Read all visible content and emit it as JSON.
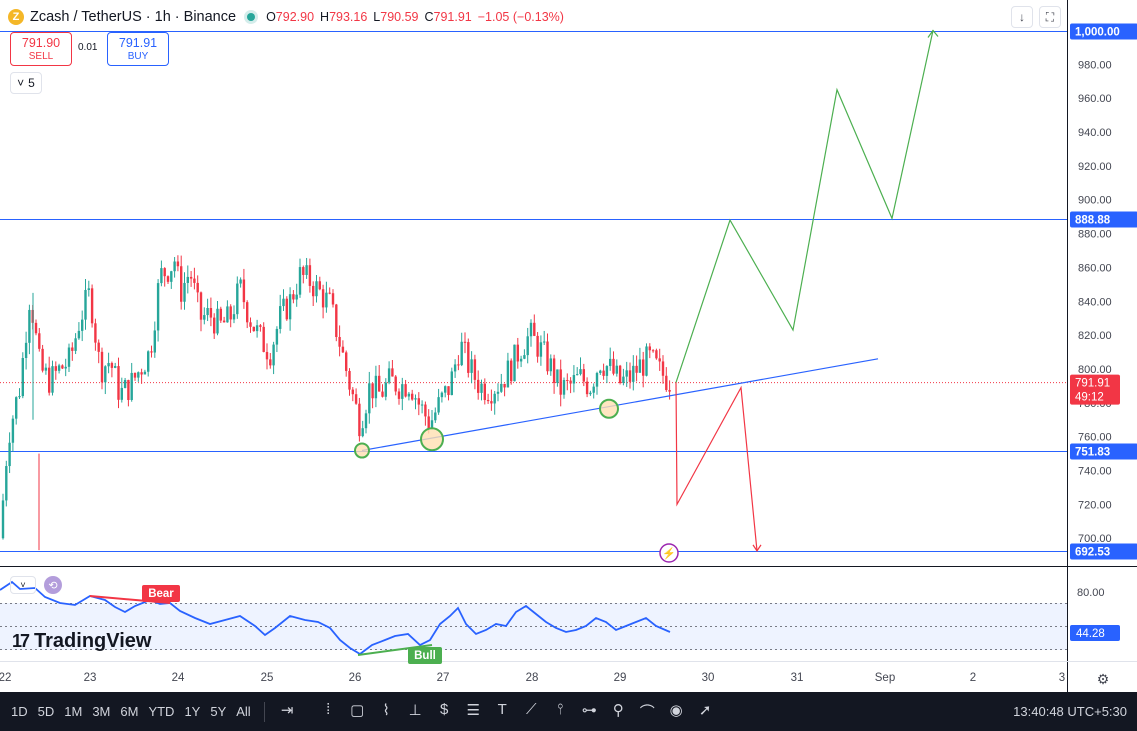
{
  "header": {
    "symbol": "Zcash / TetherUS · 1h · Binance",
    "coin_glyph": "Z",
    "open_label": "O",
    "open": "792.90",
    "high_label": "H",
    "high": "793.16",
    "low_label": "L",
    "low": "790.59",
    "close_label": "C",
    "close": "791.91",
    "change": "−1.05 (−0.13%)",
    "indicator_count": "5",
    "chevron": "˅"
  },
  "trade": {
    "sell_price": "791.90",
    "sell_label": "SELL",
    "spread": "0.01",
    "buy_price": "791.91",
    "buy_label": "BUY"
  },
  "colors": {
    "bull": "#26a69a",
    "bear": "#f23645",
    "accent": "#2962ff",
    "green_path": "#4caf50",
    "red_path": "#f23645",
    "rsi_line": "#2962ff"
  },
  "chart_data": {
    "type": "candlestick",
    "interval": "1h",
    "ylim": [
      688,
      1014
    ],
    "y_ticks": [
      1000,
      980,
      960,
      940,
      920,
      900,
      880,
      860,
      840,
      820,
      800,
      780,
      760,
      740,
      720,
      700
    ],
    "y_tick_labels": [
      "1,000.00",
      "980.00",
      "960.00",
      "940.00",
      "920.00",
      "900.00",
      "880.00",
      "860.00",
      "840.00",
      "820.00",
      "800.00",
      "780.00",
      "760.00",
      "740.00",
      "720.00",
      "700.00"
    ],
    "x_tick_labels": [
      "22",
      "23",
      "24",
      "25",
      "26",
      "27",
      "28",
      "29",
      "30",
      "31",
      "Sep",
      "2",
      "3"
    ],
    "key_levels": [
      {
        "value": 1000.0,
        "label": "1,000.00"
      },
      {
        "value": 888.88,
        "label": "888.88"
      },
      {
        "value": 751.83,
        "label": "751.83"
      },
      {
        "value": 692.53,
        "label": "692.53"
      }
    ],
    "last_price": {
      "value": 791.91,
      "label": "791.91",
      "countdown": "49:12"
    },
    "price_path": [
      [
        0,
        700
      ],
      [
        8,
        760
      ],
      [
        20,
        790
      ],
      [
        30,
        845
      ],
      [
        40,
        800
      ],
      [
        50,
        793
      ],
      [
        60,
        800
      ],
      [
        70,
        805
      ],
      [
        80,
        830
      ],
      [
        90,
        845
      ],
      [
        100,
        800
      ],
      [
        110,
        805
      ],
      [
        120,
        785
      ],
      [
        130,
        790
      ],
      [
        140,
        800
      ],
      [
        150,
        810
      ],
      [
        160,
        855
      ],
      [
        170,
        860
      ],
      [
        175,
        865
      ],
      [
        180,
        845
      ],
      [
        190,
        858
      ],
      [
        200,
        830
      ],
      [
        210,
        832
      ],
      [
        220,
        825
      ],
      [
        230,
        830
      ],
      [
        240,
        848
      ],
      [
        250,
        830
      ],
      [
        260,
        818
      ],
      [
        270,
        810
      ],
      [
        280,
        830
      ],
      [
        290,
        840
      ],
      [
        300,
        855
      ],
      [
        310,
        852
      ],
      [
        320,
        845
      ],
      [
        330,
        838
      ],
      [
        340,
        815
      ],
      [
        350,
        790
      ],
      [
        360,
        768
      ],
      [
        370,
        790
      ],
      [
        380,
        785
      ],
      [
        390,
        793
      ],
      [
        400,
        790
      ],
      [
        410,
        792
      ],
      [
        420,
        778
      ],
      [
        430,
        768
      ],
      [
        440,
        780
      ],
      [
        450,
        790
      ],
      [
        460,
        815
      ],
      [
        470,
        800
      ],
      [
        480,
        790
      ],
      [
        490,
        788
      ],
      [
        500,
        792
      ],
      [
        510,
        800
      ],
      [
        520,
        812
      ],
      [
        530,
        820
      ],
      [
        540,
        812
      ],
      [
        550,
        802
      ],
      [
        560,
        788
      ],
      [
        570,
        790
      ],
      [
        580,
        795
      ],
      [
        590,
        790
      ],
      [
        600,
        805
      ],
      [
        610,
        800
      ],
      [
        620,
        792
      ],
      [
        630,
        795
      ],
      [
        640,
        802
      ],
      [
        650,
        806
      ],
      [
        660,
        798
      ],
      [
        670,
        793
      ]
    ],
    "projections": {
      "bullish": [
        [
          676,
          792
        ],
        [
          730,
          888
        ],
        [
          793,
          823
        ],
        [
          837,
          965
        ],
        [
          892,
          889
        ],
        [
          933,
          1000
        ]
      ],
      "bearish": [
        [
          676,
          792
        ],
        [
          677,
          720
        ],
        [
          741,
          789
        ],
        [
          757,
          692.53
        ]
      ]
    },
    "trendline": [
      [
        362,
        751.83
      ],
      [
        878,
        806
      ]
    ],
    "touch_points": [
      [
        362,
        751.8,
        "small"
      ],
      [
        432,
        758.5,
        "large"
      ],
      [
        609,
        776.5,
        "medium"
      ]
    ]
  },
  "rsi": {
    "levels": [
      "80.00"
    ],
    "current": "44.28",
    "bear_label": "Bear",
    "bull_label": "Bull",
    "values": [
      [
        0,
        590
      ],
      [
        12,
        582
      ],
      [
        20,
        589
      ],
      [
        35,
        588
      ],
      [
        45,
        597
      ],
      [
        60,
        603
      ],
      [
        75,
        605
      ],
      [
        90,
        596
      ],
      [
        105,
        600
      ],
      [
        115,
        607
      ],
      [
        125,
        612
      ],
      [
        135,
        606
      ],
      [
        150,
        600
      ],
      [
        160,
        604
      ],
      [
        170,
        603
      ],
      [
        180,
        611
      ],
      [
        195,
        618
      ],
      [
        210,
        624
      ],
      [
        225,
        620
      ],
      [
        240,
        616
      ],
      [
        255,
        626
      ],
      [
        265,
        635
      ],
      [
        275,
        628
      ],
      [
        290,
        616
      ],
      [
        305,
        620
      ],
      [
        318,
        622
      ],
      [
        330,
        628
      ],
      [
        340,
        640
      ],
      [
        350,
        648
      ],
      [
        360,
        654
      ],
      [
        372,
        645
      ],
      [
        385,
        640
      ],
      [
        395,
        636
      ],
      [
        408,
        634
      ],
      [
        420,
        645
      ],
      [
        430,
        640
      ],
      [
        440,
        624
      ],
      [
        450,
        616
      ],
      [
        458,
        608
      ],
      [
        466,
        624
      ],
      [
        476,
        634
      ],
      [
        486,
        630
      ],
      [
        496,
        624
      ],
      [
        506,
        626
      ],
      [
        516,
        612
      ],
      [
        526,
        606
      ],
      [
        536,
        614
      ],
      [
        546,
        622
      ],
      [
        556,
        628
      ],
      [
        566,
        632
      ],
      [
        576,
        630
      ],
      [
        586,
        626
      ],
      [
        596,
        618
      ],
      [
        606,
        622
      ],
      [
        616,
        630
      ],
      [
        626,
        626
      ],
      [
        636,
        622
      ],
      [
        646,
        618
      ],
      [
        656,
        626
      ],
      [
        670,
        632
      ]
    ]
  },
  "branding": {
    "logo_mark": "17",
    "logo_text": "TradingView"
  },
  "bottom": {
    "ranges": [
      "1D",
      "5D",
      "1M",
      "3M",
      "6M",
      "YTD",
      "1Y",
      "5Y",
      "All"
    ],
    "time": "13:40:48 UTC+5:30"
  }
}
